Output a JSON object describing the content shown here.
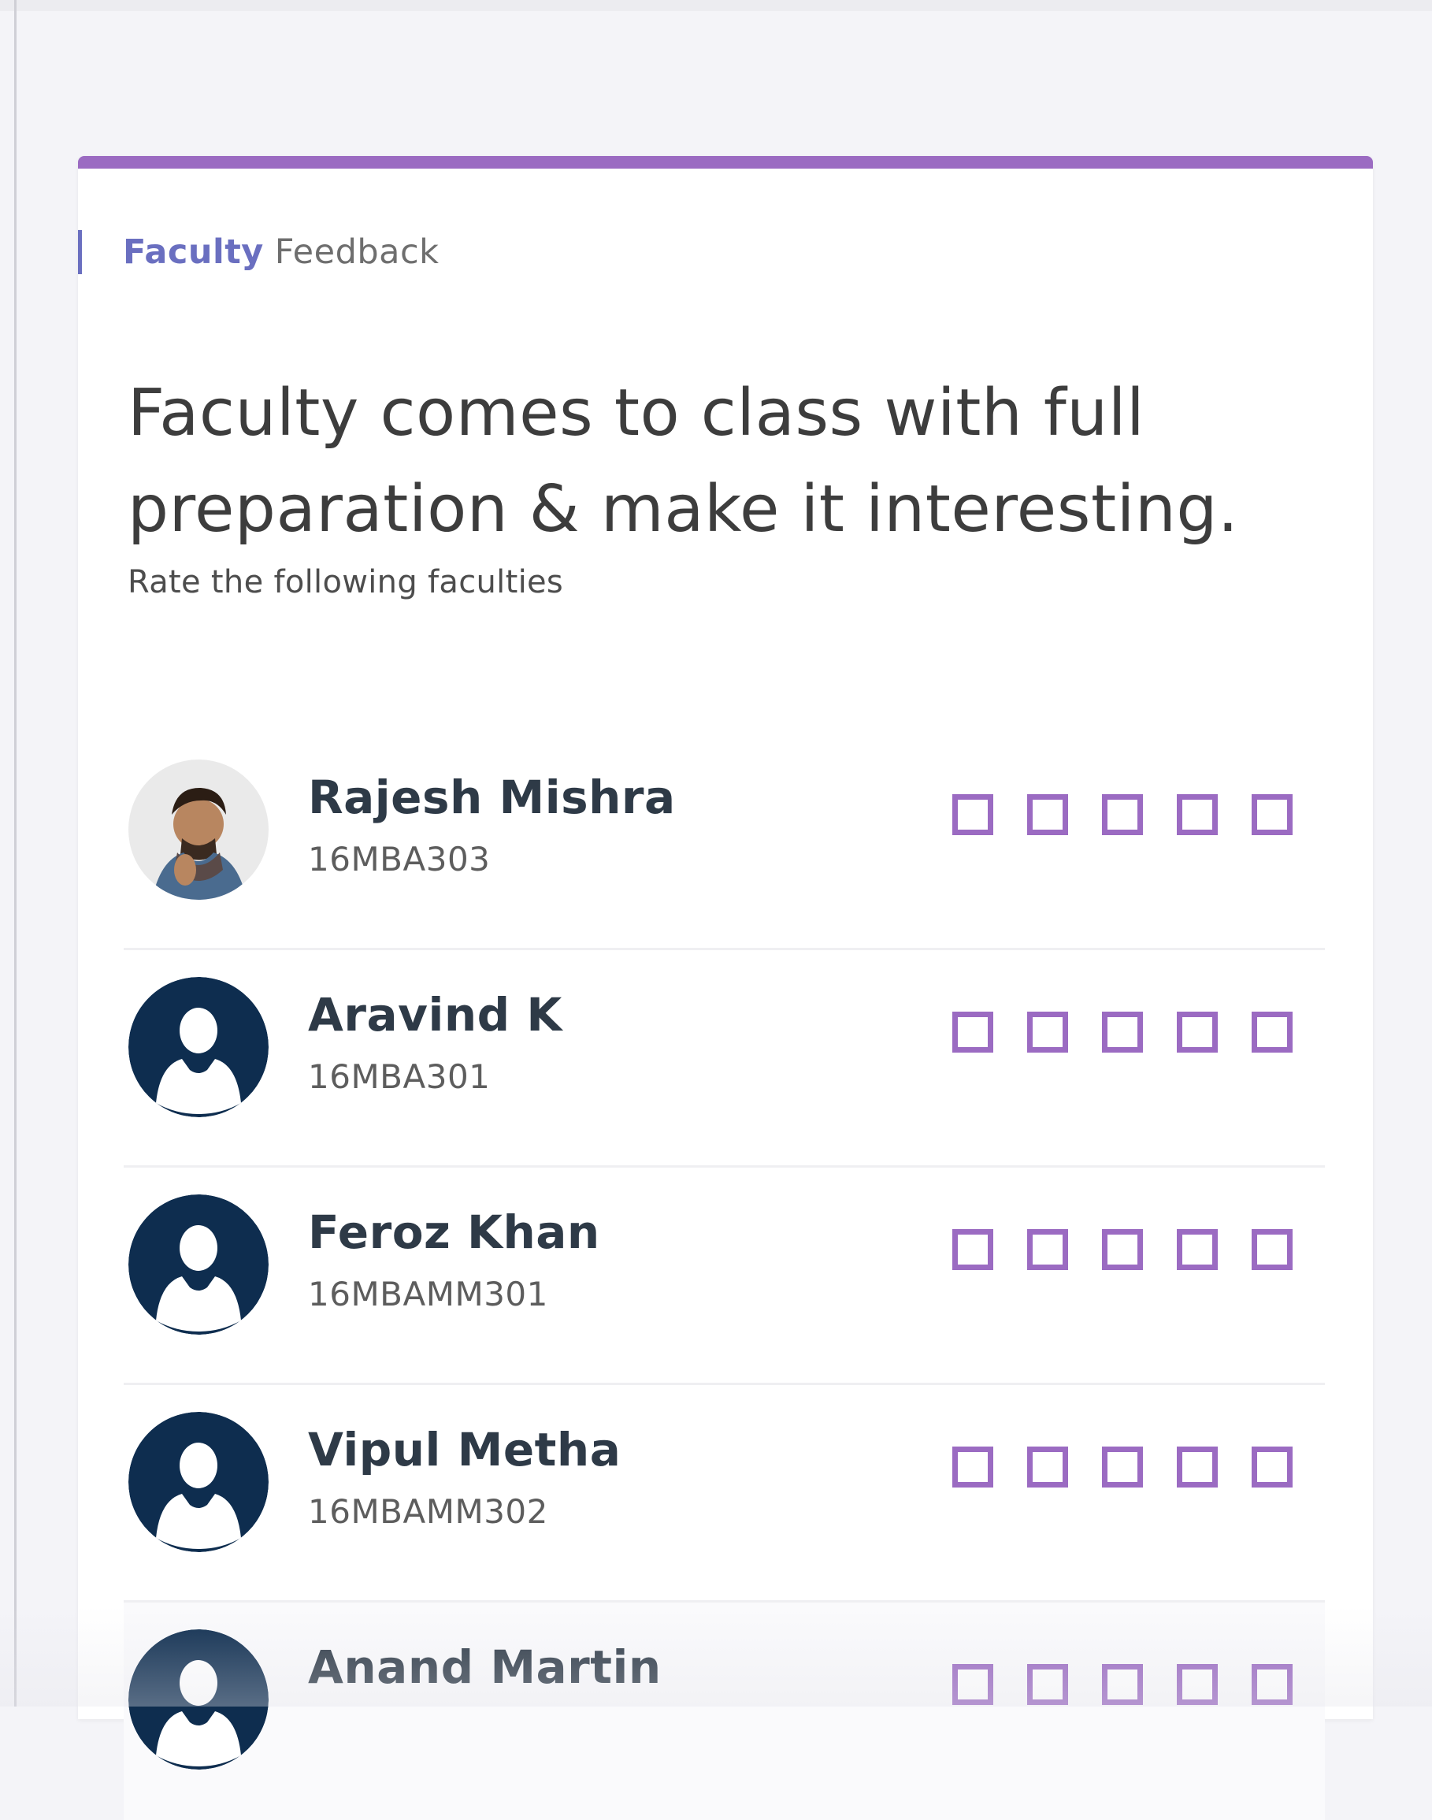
{
  "header": {
    "title": "Faculty",
    "subtitle": "Feedback"
  },
  "question": {
    "text": "Faculty comes to class with full preparation & make it interesting.",
    "instruction": "Rate the following faculties"
  },
  "faculty": [
    {
      "name": "Rajesh Mishra",
      "code": "16MBA303",
      "avatar": "photo-avatar"
    },
    {
      "name": "Aravind K",
      "code": "16MBA301",
      "avatar": "user-silhouette-icon"
    },
    {
      "name": "Feroz Khan",
      "code": "16MBAMM301",
      "avatar": "user-silhouette-icon"
    },
    {
      "name": "Vipul Metha",
      "code": "16MBAMM302",
      "avatar": "user-silhouette-icon"
    },
    {
      "name": "Anand Martin",
      "code": "",
      "avatar": "user-silhouette-icon"
    }
  ],
  "rating_scale": {
    "count": 5
  },
  "colors": {
    "accent": "#9b6bc2",
    "header_title": "#6a6fc0",
    "avatar_bg": "#0e2d4f",
    "name_text": "#2e3a47"
  }
}
